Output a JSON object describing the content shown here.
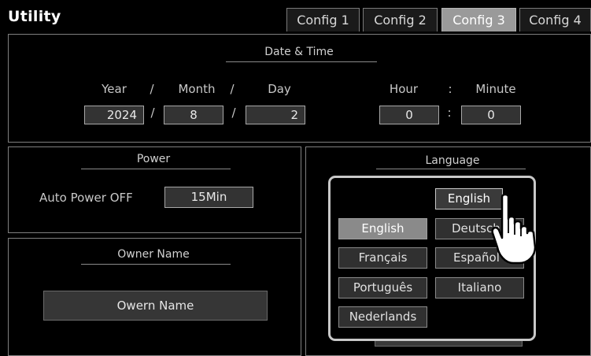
{
  "app_title": "Utility",
  "tabs": [
    {
      "label": "Config 1",
      "active": false
    },
    {
      "label": "Config 2",
      "active": false
    },
    {
      "label": "Config 3",
      "active": true
    },
    {
      "label": "Config 4",
      "active": false
    }
  ],
  "date_time": {
    "title": "Date & Time",
    "year_label": "Year",
    "month_label": "Month",
    "day_label": "Day",
    "hour_label": "Hour",
    "minute_label": "Minute",
    "slash": "/",
    "colon": ":",
    "year": "2024",
    "month": "8",
    "day": "2",
    "hour": "0",
    "minute": "0"
  },
  "power": {
    "title": "Power",
    "auto_power_label": "Auto Power OFF",
    "auto_power_value": "15Min"
  },
  "owner": {
    "title": "Owner Name",
    "name": "Owern Name"
  },
  "language": {
    "title": "Language",
    "current": "English",
    "options": [
      "English",
      "Deutsch",
      "Français",
      "Español",
      "Português",
      "Italiano",
      "Nederlands"
    ],
    "selected": "English"
  },
  "icons": {
    "hand": "pointing-hand-icon"
  }
}
